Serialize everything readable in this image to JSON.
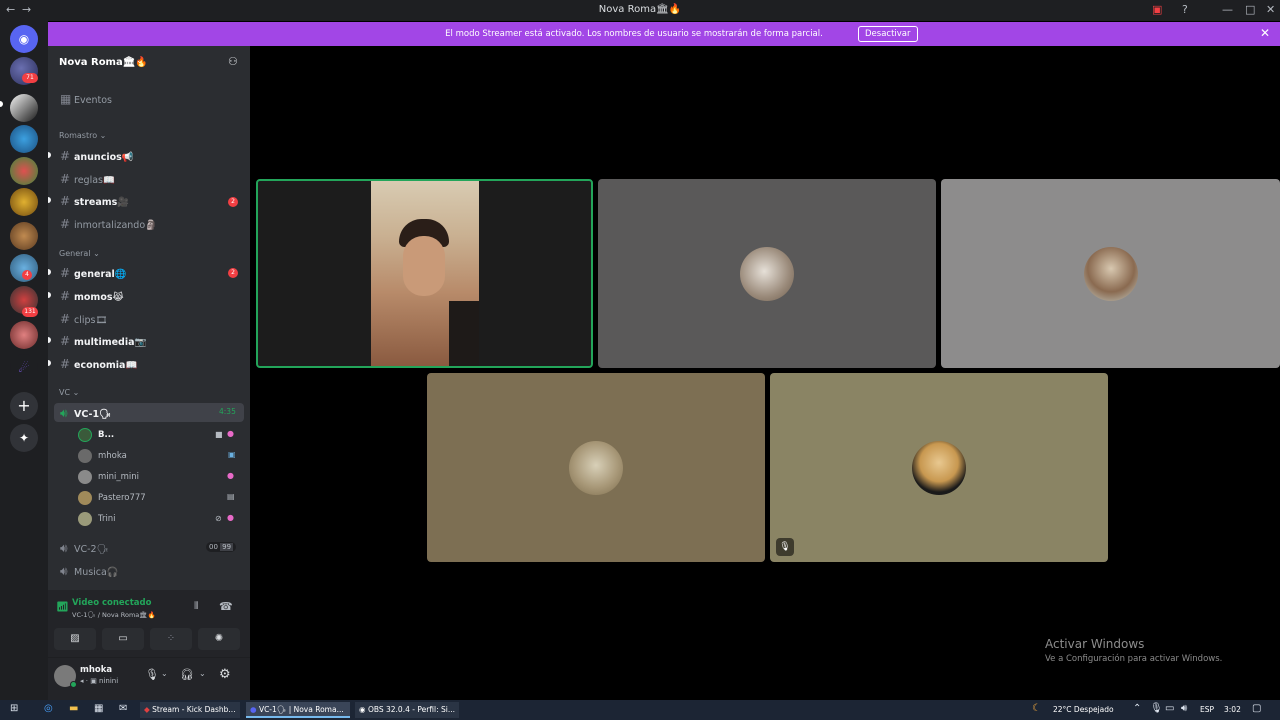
{
  "window": {
    "title": "Nova Roma🏛🔥"
  },
  "banner": {
    "text": "El modo Streamer está activado. Los nombres de usuario se mostrarán de forma parcial.",
    "button": "Desactivar"
  },
  "rail": {
    "badges": [
      "71",
      "4",
      "131"
    ]
  },
  "server": {
    "name": "Nova Roma🏛🔥",
    "events": "Eventos"
  },
  "categories": {
    "romastro": "Romastro",
    "general": "General",
    "vc": "VC"
  },
  "channels": {
    "anuncios": "anuncios📢",
    "reglas": "reglas📖",
    "streams": "streams🎥",
    "inmortalizando": "inmortalizando🗿",
    "general": "general🌐",
    "momos": "momos😹",
    "clips": "clips🎞",
    "multimedia": "multimedia📷",
    "economia": "economia📖"
  },
  "mentions": {
    "streams": "2",
    "general": "2"
  },
  "voice": {
    "vc1": {
      "name": "VC-1🗣",
      "time": "4:35"
    },
    "users": [
      "B...",
      "mhoka",
      "mini_mini",
      "Pastero777",
      "Trini"
    ],
    "vc2": {
      "name": "VC-2🗣",
      "counter_a": "00",
      "counter_b": "99"
    },
    "musica": "Musica🎧"
  },
  "connection": {
    "status": "Video conectado",
    "location": "VC-1🗣 / Nova Roma🏛🔥"
  },
  "user": {
    "name": "mhoka",
    "status": "ninini"
  },
  "taskbar": {
    "apps": [
      "Stream - Kick Dashb...",
      "VC-1🗣 | Nova Roma...",
      "OBS 32.0.4 - Perfil: Si..."
    ],
    "weather_temp": "22°C",
    "weather_desc": "Despejado",
    "lang": "ESP",
    "time": "3:02"
  },
  "watermark": {
    "title": "Activar Windows",
    "subtitle": "Ve a Configuración para activar Windows."
  },
  "colors": {
    "accent": "#a246e6",
    "speaking": "#23a55a",
    "mention": "#f23f43"
  }
}
